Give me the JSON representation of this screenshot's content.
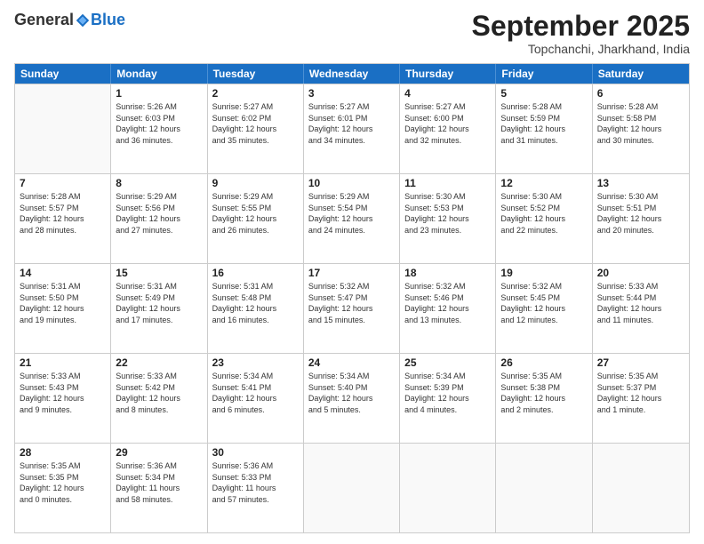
{
  "header": {
    "logo_general": "General",
    "logo_blue": "Blue",
    "month_title": "September 2025",
    "location": "Topchanchi, Jharkhand, India"
  },
  "weekdays": [
    "Sunday",
    "Monday",
    "Tuesday",
    "Wednesday",
    "Thursday",
    "Friday",
    "Saturday"
  ],
  "rows": [
    [
      {
        "day": "",
        "info": ""
      },
      {
        "day": "1",
        "info": "Sunrise: 5:26 AM\nSunset: 6:03 PM\nDaylight: 12 hours\nand 36 minutes."
      },
      {
        "day": "2",
        "info": "Sunrise: 5:27 AM\nSunset: 6:02 PM\nDaylight: 12 hours\nand 35 minutes."
      },
      {
        "day": "3",
        "info": "Sunrise: 5:27 AM\nSunset: 6:01 PM\nDaylight: 12 hours\nand 34 minutes."
      },
      {
        "day": "4",
        "info": "Sunrise: 5:27 AM\nSunset: 6:00 PM\nDaylight: 12 hours\nand 32 minutes."
      },
      {
        "day": "5",
        "info": "Sunrise: 5:28 AM\nSunset: 5:59 PM\nDaylight: 12 hours\nand 31 minutes."
      },
      {
        "day": "6",
        "info": "Sunrise: 5:28 AM\nSunset: 5:58 PM\nDaylight: 12 hours\nand 30 minutes."
      }
    ],
    [
      {
        "day": "7",
        "info": "Sunrise: 5:28 AM\nSunset: 5:57 PM\nDaylight: 12 hours\nand 28 minutes."
      },
      {
        "day": "8",
        "info": "Sunrise: 5:29 AM\nSunset: 5:56 PM\nDaylight: 12 hours\nand 27 minutes."
      },
      {
        "day": "9",
        "info": "Sunrise: 5:29 AM\nSunset: 5:55 PM\nDaylight: 12 hours\nand 26 minutes."
      },
      {
        "day": "10",
        "info": "Sunrise: 5:29 AM\nSunset: 5:54 PM\nDaylight: 12 hours\nand 24 minutes."
      },
      {
        "day": "11",
        "info": "Sunrise: 5:30 AM\nSunset: 5:53 PM\nDaylight: 12 hours\nand 23 minutes."
      },
      {
        "day": "12",
        "info": "Sunrise: 5:30 AM\nSunset: 5:52 PM\nDaylight: 12 hours\nand 22 minutes."
      },
      {
        "day": "13",
        "info": "Sunrise: 5:30 AM\nSunset: 5:51 PM\nDaylight: 12 hours\nand 20 minutes."
      }
    ],
    [
      {
        "day": "14",
        "info": "Sunrise: 5:31 AM\nSunset: 5:50 PM\nDaylight: 12 hours\nand 19 minutes."
      },
      {
        "day": "15",
        "info": "Sunrise: 5:31 AM\nSunset: 5:49 PM\nDaylight: 12 hours\nand 17 minutes."
      },
      {
        "day": "16",
        "info": "Sunrise: 5:31 AM\nSunset: 5:48 PM\nDaylight: 12 hours\nand 16 minutes."
      },
      {
        "day": "17",
        "info": "Sunrise: 5:32 AM\nSunset: 5:47 PM\nDaylight: 12 hours\nand 15 minutes."
      },
      {
        "day": "18",
        "info": "Sunrise: 5:32 AM\nSunset: 5:46 PM\nDaylight: 12 hours\nand 13 minutes."
      },
      {
        "day": "19",
        "info": "Sunrise: 5:32 AM\nSunset: 5:45 PM\nDaylight: 12 hours\nand 12 minutes."
      },
      {
        "day": "20",
        "info": "Sunrise: 5:33 AM\nSunset: 5:44 PM\nDaylight: 12 hours\nand 11 minutes."
      }
    ],
    [
      {
        "day": "21",
        "info": "Sunrise: 5:33 AM\nSunset: 5:43 PM\nDaylight: 12 hours\nand 9 minutes."
      },
      {
        "day": "22",
        "info": "Sunrise: 5:33 AM\nSunset: 5:42 PM\nDaylight: 12 hours\nand 8 minutes."
      },
      {
        "day": "23",
        "info": "Sunrise: 5:34 AM\nSunset: 5:41 PM\nDaylight: 12 hours\nand 6 minutes."
      },
      {
        "day": "24",
        "info": "Sunrise: 5:34 AM\nSunset: 5:40 PM\nDaylight: 12 hours\nand 5 minutes."
      },
      {
        "day": "25",
        "info": "Sunrise: 5:34 AM\nSunset: 5:39 PM\nDaylight: 12 hours\nand 4 minutes."
      },
      {
        "day": "26",
        "info": "Sunrise: 5:35 AM\nSunset: 5:38 PM\nDaylight: 12 hours\nand 2 minutes."
      },
      {
        "day": "27",
        "info": "Sunrise: 5:35 AM\nSunset: 5:37 PM\nDaylight: 12 hours\nand 1 minute."
      }
    ],
    [
      {
        "day": "28",
        "info": "Sunrise: 5:35 AM\nSunset: 5:35 PM\nDaylight: 12 hours\nand 0 minutes."
      },
      {
        "day": "29",
        "info": "Sunrise: 5:36 AM\nSunset: 5:34 PM\nDaylight: 11 hours\nand 58 minutes."
      },
      {
        "day": "30",
        "info": "Sunrise: 5:36 AM\nSunset: 5:33 PM\nDaylight: 11 hours\nand 57 minutes."
      },
      {
        "day": "",
        "info": ""
      },
      {
        "day": "",
        "info": ""
      },
      {
        "day": "",
        "info": ""
      },
      {
        "day": "",
        "info": ""
      }
    ]
  ]
}
